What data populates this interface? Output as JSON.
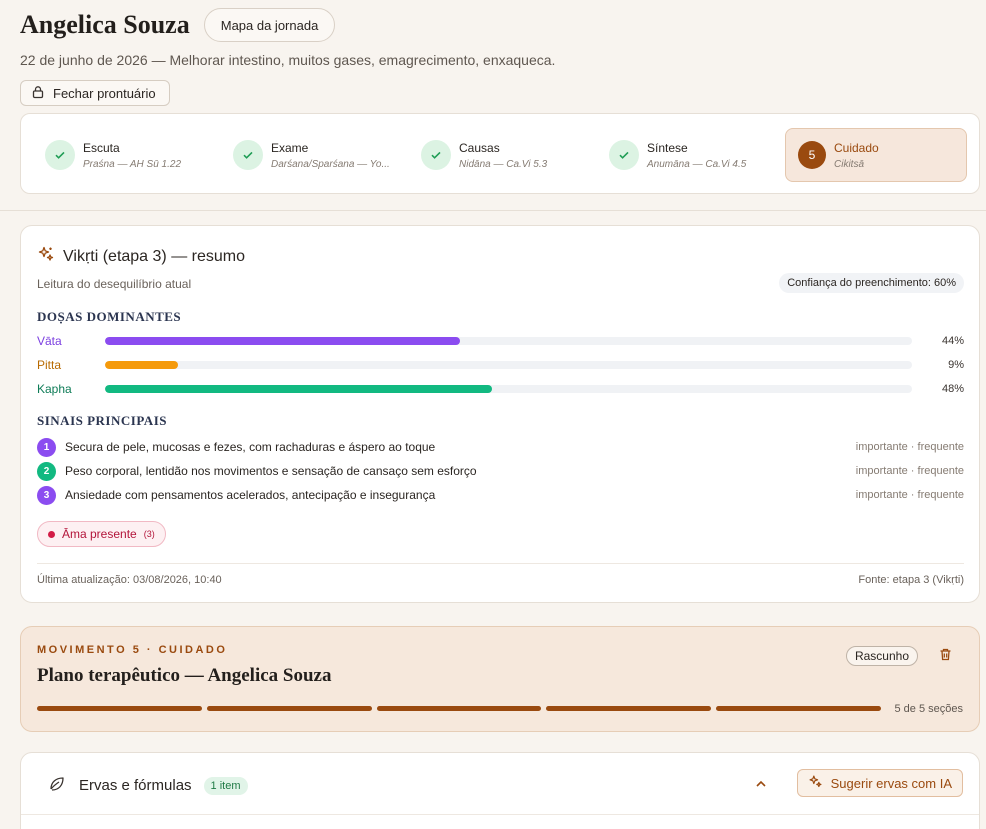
{
  "header": {
    "patient_name": "Angelica Souza",
    "journey_map_label": "Mapa da jornada",
    "subtitle": "22 de junho de 2026 — Melhorar intestino, muitos gases, emagrecimento, enxaqueca.",
    "close_record_label": "Fechar prontuário"
  },
  "stepper": {
    "steps": [
      {
        "label": "Escuta",
        "sub": "Praśna — AH Sū 1.22",
        "state": "done"
      },
      {
        "label": "Exame",
        "sub": "Darśana/Sparśana — Yo...",
        "state": "done"
      },
      {
        "label": "Causas",
        "sub": "Nidāna — Ca.Vi 5.3",
        "state": "done"
      },
      {
        "label": "Síntese",
        "sub": "Anumāna — Ca.Vi 4.5",
        "state": "done"
      },
      {
        "number": "5",
        "label": "Cuidado",
        "sub": "Cikitsā",
        "state": "active"
      }
    ]
  },
  "summary": {
    "title": "Vikṛti (etapa 3) — resumo",
    "description": "Leitura do desequilíbrio atual",
    "confidence": "Confiança do preenchimento: 60%",
    "doshas_heading": "DOṢAS DOMINANTES",
    "doshas": [
      {
        "name": "Vāta",
        "percent_label": "44%",
        "value": 44,
        "color": "#8b4cf0"
      },
      {
        "name": "Pitta",
        "percent_label": "9%",
        "value": 9,
        "color": "#f59a0b"
      },
      {
        "name": "Kapha",
        "percent_label": "48%",
        "value": 48,
        "color": "#12b981"
      }
    ],
    "signs_heading": "SINAIS PRINCIPAIS",
    "signs": [
      {
        "number": "1",
        "text": "Secura de pele, mucosas e fezes, com rachaduras e áspero ao toque",
        "tag": "importante · frequente",
        "color": "#8b4cf0"
      },
      {
        "number": "2",
        "text": "Peso corporal, lentidão nos movimentos e sensação de cansaço sem esforço",
        "tag": "importante · frequente",
        "color": "#12b981"
      },
      {
        "number": "3",
        "text": "Ansiedade com pensamentos acelerados, antecipação e insegurança",
        "tag": "importante · frequente",
        "color": "#8b4cf0"
      }
    ],
    "ama": {
      "label": "Āma presente",
      "count": "(3)"
    },
    "last_update": "Última atualização: 03/08/2026, 10:40",
    "source": "Fonte: etapa 3 (Vikṛti)"
  },
  "plan": {
    "eyebrow": "MOVIMENTO 5 · CUIDADO",
    "title": "Plano terapêutico — Angelica Souza",
    "status": "Rascunho",
    "sections_done": 5,
    "sections_total": 5,
    "sections_label": "5 de 5 seções"
  },
  "herbs": {
    "title": "Ervas e fórmulas",
    "count": "1 item",
    "suggest_label": "Sugerir ervas com IA"
  },
  "colors": {
    "accent": "#9a4a0f",
    "success": "#1f9d55",
    "danger": "#d21c46"
  }
}
